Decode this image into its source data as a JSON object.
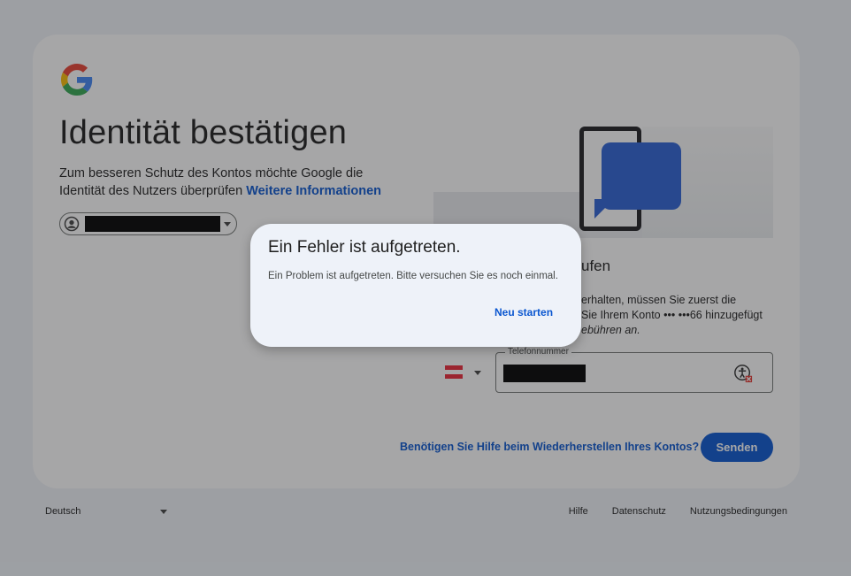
{
  "page": {
    "title": "Identität bestätigen",
    "subtitle": "Zum besseren Schutz des Kontos möchte Google die Identität des Nutzers überprüfen",
    "more_info_link": "Weitere Informationen"
  },
  "verification": {
    "heading_partial": "ufen",
    "text_line1": "erhalten, müssen Sie zuerst die",
    "text_line2": "Sie Ihrem Konto ••• •••66 hinzugefügt",
    "text_line3": "ebühren an.",
    "phone_label": "Telefonnummer",
    "country_flag": "austria-flag"
  },
  "actions": {
    "help_link": "Benötigen Sie Hilfe beim Wiederherstellen Ihres Kontos?",
    "send_button": "Senden"
  },
  "footer": {
    "language": "Deutsch",
    "links": [
      "Hilfe",
      "Datenschutz",
      "Nutzungsbedingungen"
    ]
  },
  "dialog": {
    "title": "Ein Fehler ist aufgetreten.",
    "body": "Ein Problem ist aufgetreten. Bitte versuchen Sie es noch einmal.",
    "button": "Neu starten"
  },
  "colors": {
    "accent": "#0b57d0",
    "background": "#f0f4f9",
    "dialog_bg": "#eef2f9",
    "bubble": "#2e63d6"
  }
}
